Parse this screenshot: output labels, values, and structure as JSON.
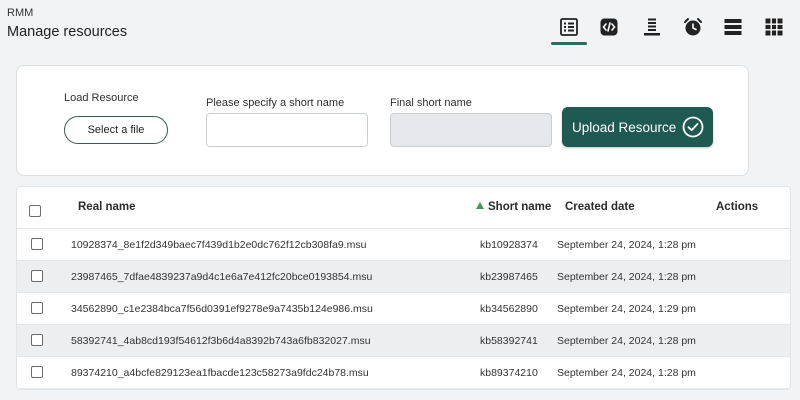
{
  "header": {
    "app_name": "RMM",
    "page_title": "Manage resources"
  },
  "toolbar": {
    "buttons": [
      {
        "icon": "list-details-icon",
        "active": true
      },
      {
        "icon": "code-icon",
        "active": false
      },
      {
        "icon": "stack-icon",
        "active": false
      },
      {
        "icon": "alarm-clock-icon",
        "active": false
      },
      {
        "icon": "rows-icon",
        "active": false
      },
      {
        "icon": "grid-icon",
        "active": false
      }
    ],
    "accent_color": "#2e6b60"
  },
  "upload": {
    "load_resource_label": "Load Resource",
    "select_file_label": "Select a file",
    "short_name_label": "Please specify a short name",
    "short_name_value": "",
    "final_short_name_label": "Final short name",
    "final_short_name_value": "",
    "upload_button_label": "Upload Resource",
    "button_color": "#1f5a52"
  },
  "table": {
    "columns": {
      "real_name": "Real name",
      "short_name": "Short name",
      "created_date": "Created date",
      "actions": "Actions"
    },
    "sorted_column": "short_name",
    "sort_direction": "ascending",
    "rows": [
      {
        "real_name": "10928374_8e1f2d349baec7f439d1b2e0dc762f12cb308fa9.msu",
        "short_name": "kb10928374",
        "created_date": "September 24, 2024, 1:28 pm"
      },
      {
        "real_name": "23987465_7dfae4839237a9d4c1e6a7e412fc20bce0193854.msu",
        "short_name": "kb23987465",
        "created_date": "September 24, 2024, 1:28 pm"
      },
      {
        "real_name": "34562890_c1e2384bca7f56d0391ef9278e9a7435b124e986.msu",
        "short_name": "kb34562890",
        "created_date": "September 24, 2024, 1:29 pm"
      },
      {
        "real_name": "58392741_4ab8cd193f54612f3b6d4a8392b743a6fb832027.msu",
        "short_name": "kb58392741",
        "created_date": "September 24, 2024, 1:28 pm"
      },
      {
        "real_name": "89374210_a4bcfe829123ea1fbacde123c58273a9fdc24b78.msu",
        "short_name": "kb89374210",
        "created_date": "September 24, 2024, 1:28 pm"
      }
    ]
  }
}
